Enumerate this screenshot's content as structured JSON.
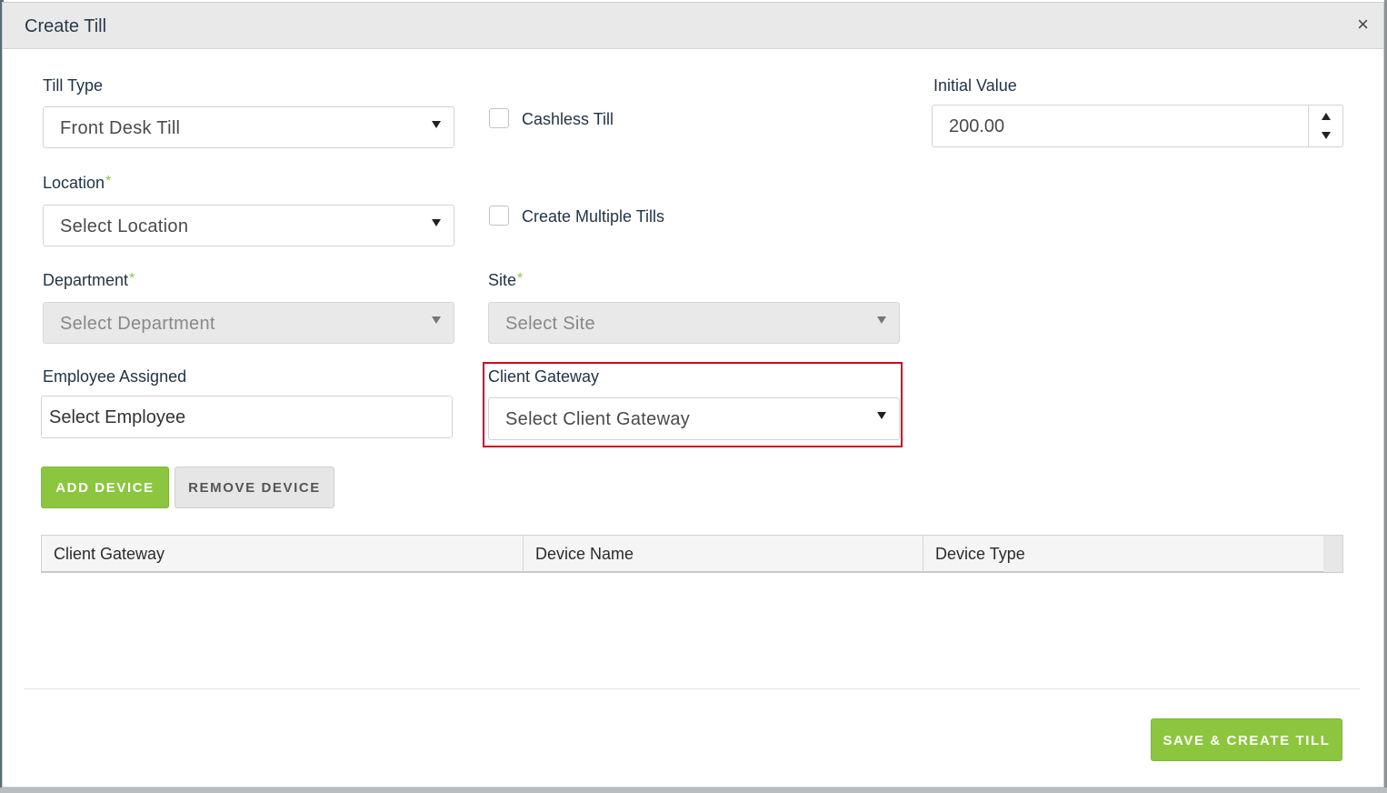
{
  "modal": {
    "title": "Create Till",
    "close_symbol": "×"
  },
  "till_type": {
    "label": "Till Type",
    "value": "Front Desk Till"
  },
  "cashless": {
    "label": "Cashless Till",
    "checked": false
  },
  "initial_value": {
    "label": "Initial Value",
    "value": "200.00"
  },
  "location": {
    "label": "Location",
    "required_mark": "*",
    "value": "Select Location"
  },
  "multiple": {
    "label": "Create Multiple Tills",
    "checked": false
  },
  "department": {
    "label": "Department",
    "required_mark": "*",
    "value": "Select Department",
    "disabled": true
  },
  "site": {
    "label": "Site",
    "required_mark": "*",
    "value": "Select Site",
    "disabled": true
  },
  "employee": {
    "label": "Employee Assigned",
    "value": "Select Employee"
  },
  "client_gateway": {
    "label": "Client Gateway",
    "value": "Select Client Gateway"
  },
  "buttons": {
    "add_device": "ADD DEVICE",
    "remove_device": "REMOVE DEVICE",
    "save": "SAVE & CREATE TILL"
  },
  "table": {
    "columns": [
      "Client Gateway",
      "Device Name",
      "Device Type"
    ]
  },
  "colors": {
    "accent_green": "#8cc63f",
    "highlight_red": "#d0021b"
  }
}
